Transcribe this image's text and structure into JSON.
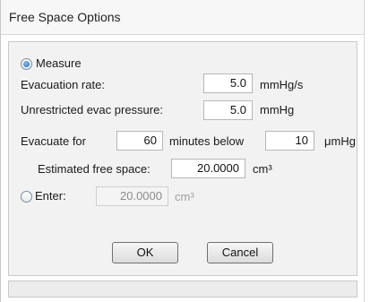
{
  "window": {
    "title": "Free Space Options"
  },
  "measure": {
    "radio_label": "Measure",
    "selected": true,
    "evacuation_rate": {
      "label": "Evacuation rate:",
      "value": "5.0",
      "unit": "mmHg/s"
    },
    "unrestricted_pressure": {
      "label": "Unrestricted evac pressure:",
      "value": "5.0",
      "unit": "mmHg"
    },
    "evacuate": {
      "label": "Evacuate for",
      "minutes_value": "60",
      "minutes_label": "minutes below",
      "pressure_value": "10",
      "pressure_unit": "μmHg"
    },
    "estimated": {
      "label": "Estimated free space:",
      "value": "20.0000",
      "unit": "cm³"
    }
  },
  "enter": {
    "radio_label": "Enter:",
    "selected": false,
    "value": "20.0000",
    "unit": "cm³"
  },
  "buttons": {
    "ok": "OK",
    "cancel": "Cancel"
  }
}
